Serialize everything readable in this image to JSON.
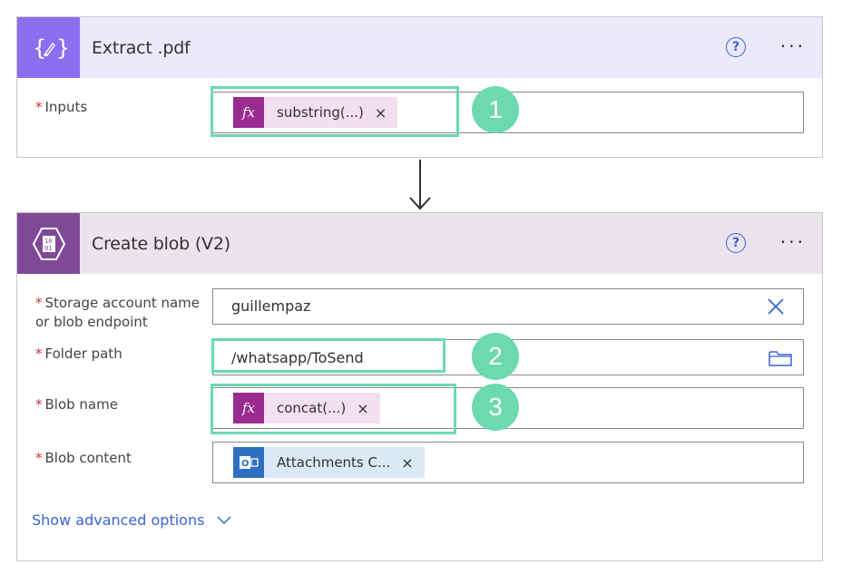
{
  "extract_card": {
    "title": "Extract .pdf",
    "icon": "curly-braces-pen-icon",
    "inputs_label": "Inputs",
    "inputs_token": {
      "icon": "fx-icon",
      "label": "substring(...)",
      "remove": "×"
    },
    "callout": "1"
  },
  "blob_card": {
    "title": "Create blob (V2)",
    "icon": "blob-storage-icon",
    "storage_label_line1": "Storage account name",
    "storage_label_line2": "or blob endpoint",
    "storage_value": "guillempaz",
    "folder_label": "Folder path",
    "folder_value": "/whatsapp/ToSend",
    "folder_callout": "2",
    "blobname_label": "Blob name",
    "blobname_token": {
      "icon": "fx-icon",
      "label": "concat(...)",
      "remove": "×"
    },
    "blobname_callout": "3",
    "content_label": "Blob content",
    "content_token": {
      "icon": "outlook-icon",
      "label": "Attachments C...",
      "remove": "×"
    },
    "advanced_label": "Show advanced options"
  },
  "common": {
    "required_mark": "*",
    "help": "?",
    "more": "···",
    "fx_glyph": "fx"
  },
  "colors": {
    "extract_accent": "#8a6ff0",
    "blob_accent": "#804998",
    "highlight": "#6dd9b0",
    "link": "#3a63d6"
  }
}
